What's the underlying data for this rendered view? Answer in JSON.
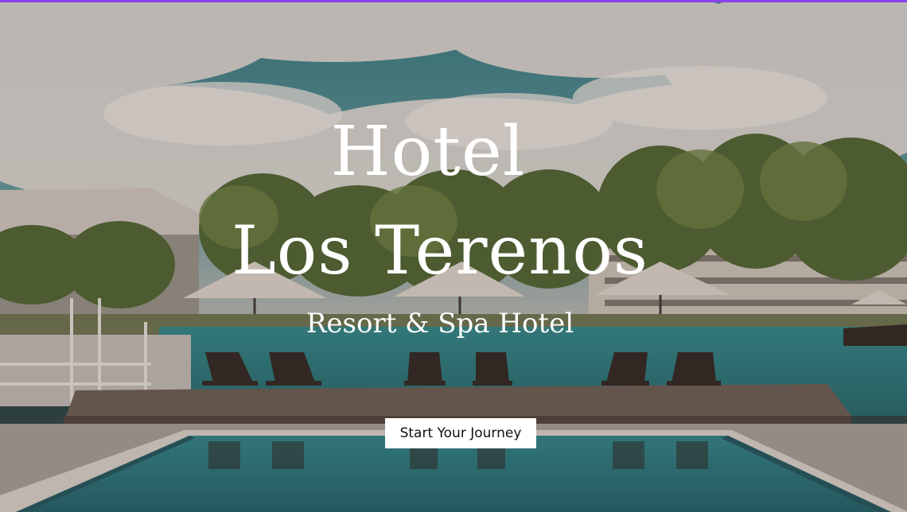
{
  "hero": {
    "title_line1": "Hotel",
    "title_line2": "Los Terenos",
    "subtitle": "Resort & Spa Hotel",
    "cta_label": "Start Your Journey"
  },
  "colors": {
    "top_accent": "#8a43f0",
    "text": "#ffffff",
    "cta_background": "#ffffff",
    "cta_text": "#111111",
    "pool_water": "#2f8a8c",
    "sky": "#3d8f98"
  }
}
